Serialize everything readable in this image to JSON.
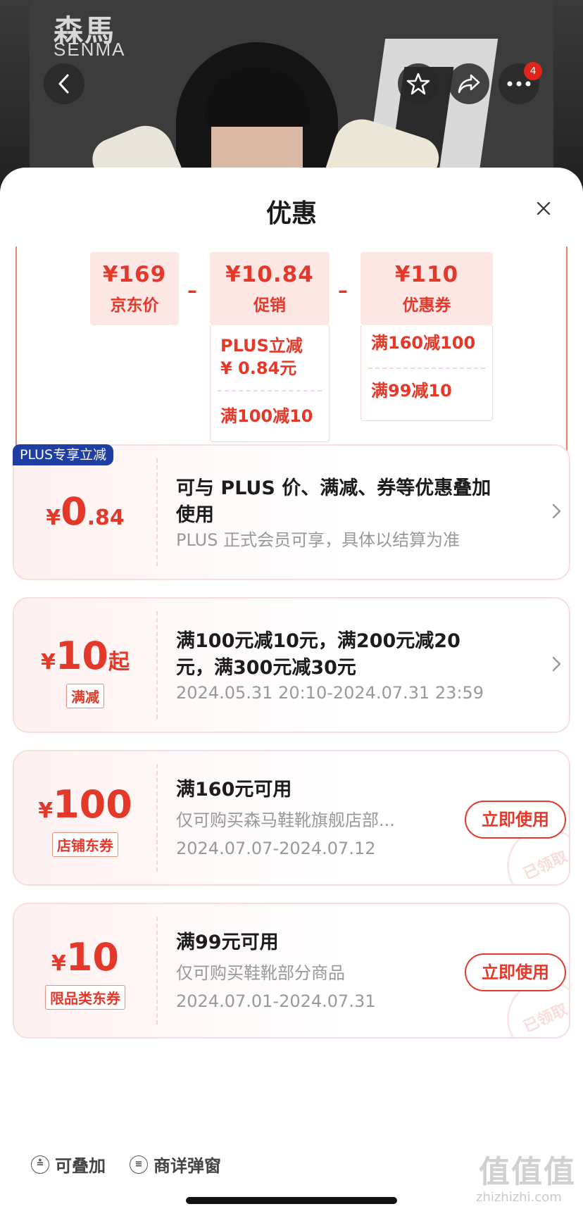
{
  "product_photo": {
    "brand_cn": "森馬",
    "brand_en": "SENMA",
    "notification_count": "4"
  },
  "sheet": {
    "title": "优惠"
  },
  "price_breakdown": {
    "jd_price": {
      "amount": "¥169",
      "label": "京东价"
    },
    "promotion": {
      "amount": "¥10.84",
      "label": "促销",
      "details": [
        "PLUS立减",
        "¥ 0.84元",
        "满100减10"
      ]
    },
    "coupon": {
      "amount": "¥110",
      "label": "优惠券",
      "details": [
        "满160减100",
        "满99减10"
      ]
    },
    "operator": "–"
  },
  "cards": [
    {
      "badge": "PLUS专享立减",
      "yen": "¥",
      "amount": "0",
      "amount_suffix": ".84",
      "title_line1": "可与 PLUS 价、满减、券等优惠叠加",
      "title_line2": "使用",
      "subtitle": "PLUS 正式会员可享，具体以结算为准"
    },
    {
      "yen": "¥",
      "amount": "10",
      "amount_suffix": "起",
      "tag": "满减",
      "title_line1": "满100元减10元，满200元减20",
      "title_line2": "元，满300元减30元",
      "subtitle": "2024.05.31 20:10-2024.07.31 23:59"
    },
    {
      "yen": "¥",
      "amount": "100",
      "tag": "店铺东券",
      "title": "满160元可用",
      "subtitle": "仅可购买森马鞋靴旗舰店部...",
      "validity": "2024.07.07-2024.07.12",
      "button": "立即使用",
      "stamp": "已领取"
    },
    {
      "yen": "¥",
      "amount": "10",
      "tag": "限品类东券",
      "title": "满99元可用",
      "subtitle": "仅可购买鞋靴部分商品",
      "validity": "2024.07.01-2024.07.31",
      "button": "立即使用",
      "stamp": "已领取"
    }
  ],
  "footer": {
    "stackable": "可叠加",
    "detail_popup": "商详弹窗"
  },
  "watermark": {
    "logo": "值值值",
    "url": "zhizhizhi.com"
  },
  "colors": {
    "accent": "#e4392a",
    "plus_badge": "#1f3ea3",
    "card_bg": "#fdf1f0",
    "price_bg": "#fde7e4"
  }
}
